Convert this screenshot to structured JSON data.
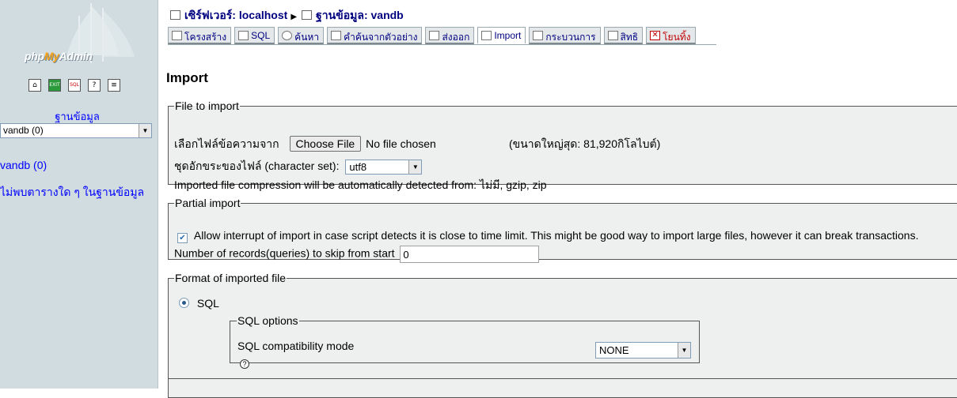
{
  "sidebar": {
    "logo_text": "phpMyAdmin",
    "nav_icons": [
      "home-icon",
      "exit-icon",
      "sql-query-icon",
      "help-icon",
      "docs-icon"
    ],
    "db_label": "ฐานข้อมูล",
    "db_select_value": "vandb (0)",
    "db_link": "vandb (0)",
    "no_tables_text": "ไม่พบตารางใด ๆ ในฐานข้อมูล"
  },
  "breadcrumb": {
    "server_label": "เซิร์ฟเวอร์: localhost",
    "database_label": "ฐานข้อมูล: vandb"
  },
  "tabs": [
    {
      "label": "โครงสร้าง",
      "icon": "structure-icon"
    },
    {
      "label": "SQL",
      "icon": "sql-icon"
    },
    {
      "label": "ค้นหา",
      "icon": "search-icon"
    },
    {
      "label": "คำค้นจากตัวอย่าง",
      "icon": "query-icon"
    },
    {
      "label": "ส่งออก",
      "icon": "export-icon"
    },
    {
      "label": "Import",
      "icon": "import-icon"
    },
    {
      "label": "กระบวนการ",
      "icon": "operations-icon"
    },
    {
      "label": "สิทธิ",
      "icon": "privileges-icon"
    },
    {
      "label": "โยนทิ้ง",
      "icon": "drop-icon"
    }
  ],
  "page_title": "Import",
  "file_section": {
    "legend": "File to import",
    "file_label": "เลือกไฟล์ข้อความจาก",
    "choose_button": "Choose File",
    "no_file_text": "No file chosen",
    "max_size": "(ขนาดใหญ่สุด: 81,920กิโลไบต์)",
    "charset_label": "ชุดอักขระของไฟล์ (character set):",
    "charset_value": "utf8",
    "compression_text": "Imported file compression will be automatically detected from: ไม่มี, gzip, zip"
  },
  "partial_section": {
    "legend": "Partial import",
    "allow_interrupt_checked": true,
    "allow_interrupt_label": "Allow interrupt of import in case script detects it is close to time limit. This might be good way to import large files, however it can break transactions.",
    "skip_label": "Number of records(queries) to skip from start",
    "skip_value": "0"
  },
  "format_section": {
    "legend": "Format of imported file",
    "format_option": "SQL",
    "format_selected": true,
    "sql_options_legend": "SQL options",
    "compat_label": "SQL compatibility mode",
    "compat_value": "NONE"
  }
}
